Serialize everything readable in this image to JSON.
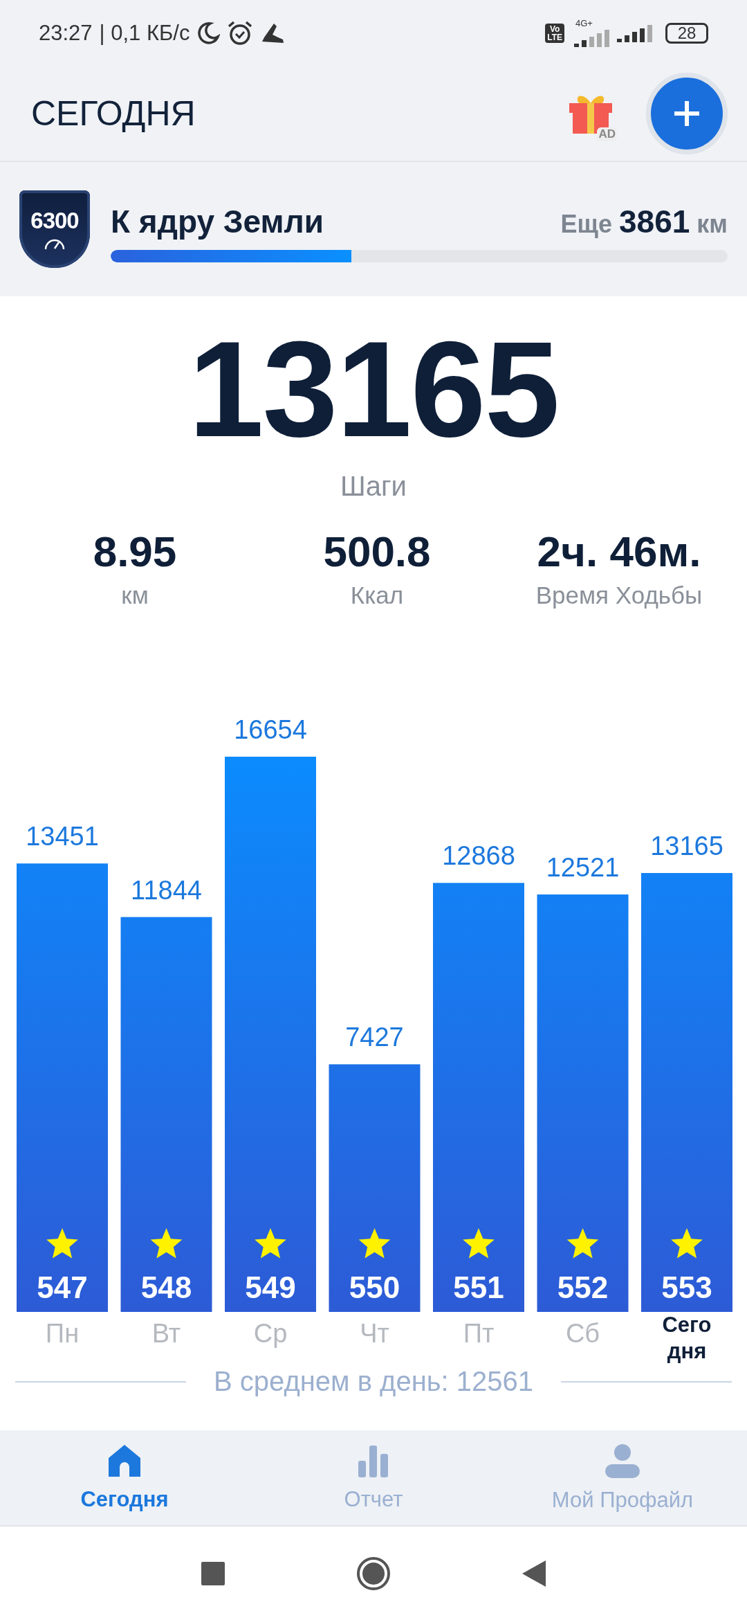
{
  "status_bar": {
    "time": "23:27",
    "speed": "| 0,1 КБ/с",
    "volte_top": "Vo",
    "volte_bottom": "LTE",
    "network_type": "4G+",
    "battery": "28"
  },
  "header": {
    "title": "СЕГОДНЯ",
    "ad_label": "AD"
  },
  "goal": {
    "badge": "6300",
    "title": "К ядру Земли",
    "remaining_prefix": "Еще",
    "remaining_value": "3861",
    "remaining_unit": "км",
    "level": 0.39
  },
  "steps": {
    "value": "13165",
    "label": "Шаги"
  },
  "stats": [
    {
      "value": "8.95",
      "label": "км"
    },
    {
      "value": "500.8",
      "label": "Ккал"
    },
    {
      "value": "2ч. 46м.",
      "label": "Время Ходьбы"
    }
  ],
  "chart_data": {
    "type": "bar",
    "categories": [
      "Пн",
      "Вт",
      "Ср",
      "Чт",
      "Пт",
      "Сб",
      "Сегодня"
    ],
    "values": [
      13451,
      11844,
      16654,
      7427,
      12868,
      12521,
      13165
    ],
    "data_labels": true
  },
  "days": [
    {
      "badge": "547",
      "selected": false
    },
    {
      "badge": "548",
      "selected": false
    },
    {
      "badge": "549",
      "selected": false
    },
    {
      "badge": "550",
      "selected": false
    },
    {
      "badge": "551",
      "selected": false
    },
    {
      "badge": "552",
      "selected": false
    },
    {
      "badge": "553",
      "selected": true
    }
  ],
  "average": "В среднем в день: 12561",
  "nav": [
    {
      "label": "Сегодня",
      "kind": "home",
      "selected": true
    },
    {
      "label": "Отчет",
      "kind": "report",
      "selected": false
    },
    {
      "label": "Мой Профайл",
      "kind": "profile",
      "selected": false
    }
  ]
}
